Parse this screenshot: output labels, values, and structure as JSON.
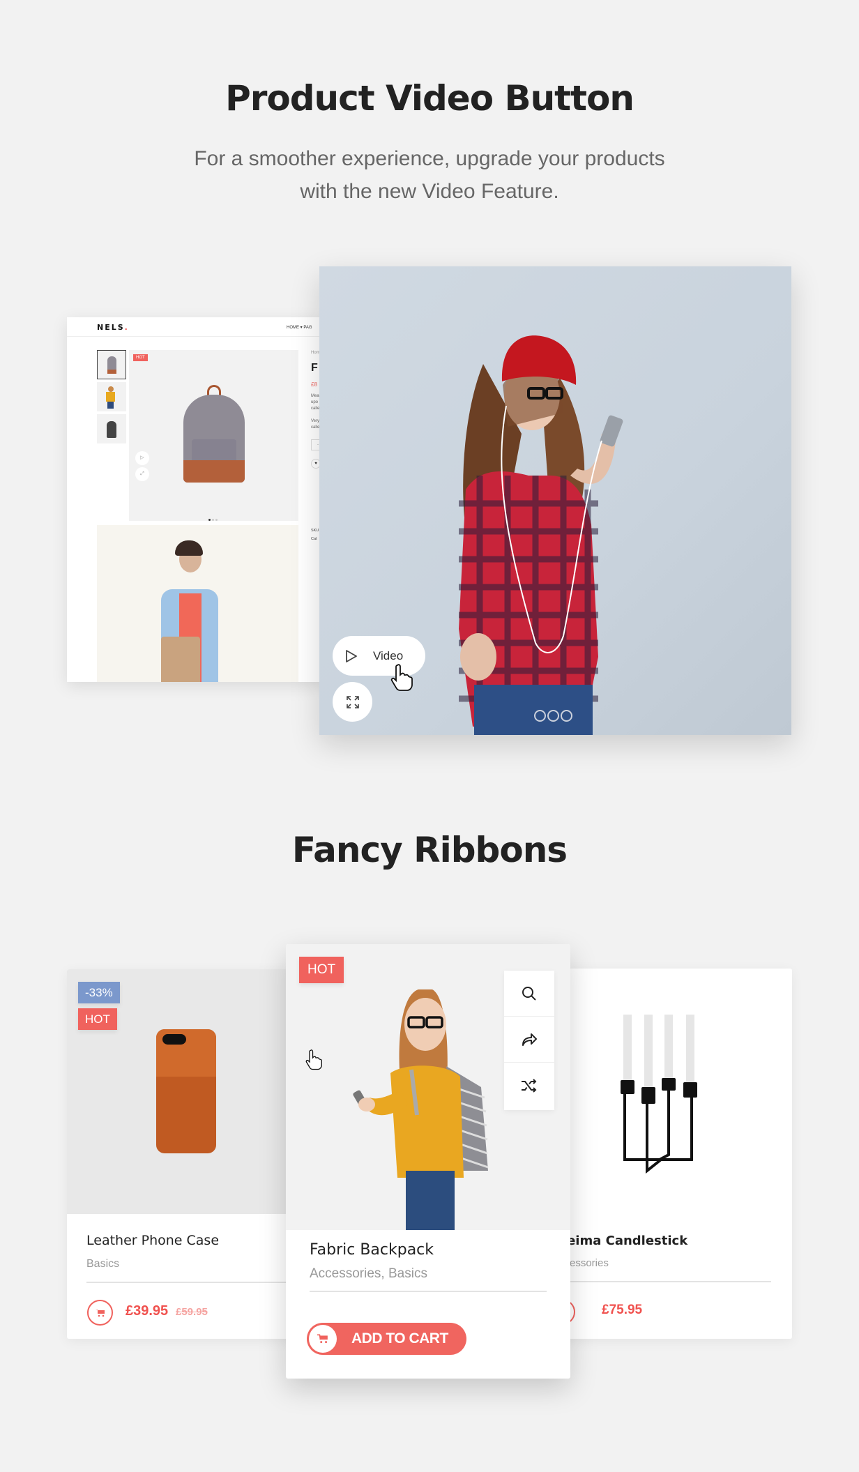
{
  "section_video": {
    "title": "Product Video Button",
    "subtitle_line1": "For a smoother experience, upgrade your products",
    "subtitle_line2": "with the new Video Feature."
  },
  "mini_store": {
    "logo": "NELS",
    "logo_dot": ".",
    "nav": "HOME ▾   PAG",
    "ribbon": "HOT",
    "breadcrumb": "Hom",
    "product_title_initial": "F",
    "price_partial": "£8",
    "desc_lines": [
      "Mea",
      "upo",
      "calle",
      "",
      "Very",
      "calle"
    ],
    "qty_minus": "-",
    "meta_lines": [
      "SKU",
      "Cat"
    ]
  },
  "hero": {
    "video_button_label": "Video",
    "play_icon": "play-icon",
    "fullscreen_icon": "expand-icon",
    "slide_count": 3
  },
  "section_ribbons": {
    "title": "Fancy Ribbons"
  },
  "products": [
    {
      "name": "Leather Phone Case",
      "category": "Basics",
      "price": "£39.95",
      "old_price": "£59.95",
      "ribbons": [
        {
          "label": "-33%",
          "color": "#7b98cc"
        },
        {
          "label": "HOT",
          "color": "#f0625d"
        }
      ]
    },
    {
      "name": "Fabric Backpack",
      "category": "Accessories, Basics",
      "add_to_cart": "ADD TO CART",
      "ribbons": [
        {
          "label": "HOT",
          "color": "#f0625d"
        }
      ],
      "tools": [
        "search-icon",
        "share-icon",
        "shuffle-icon"
      ]
    },
    {
      "name": "Heima Candlestick",
      "name_visible": "leima Candlestick",
      "category_visible": "ccessories",
      "price": "£75.95"
    }
  ],
  "colors": {
    "accent": "#f0625d",
    "discount": "#7b98cc",
    "background": "#f2f2f2"
  }
}
